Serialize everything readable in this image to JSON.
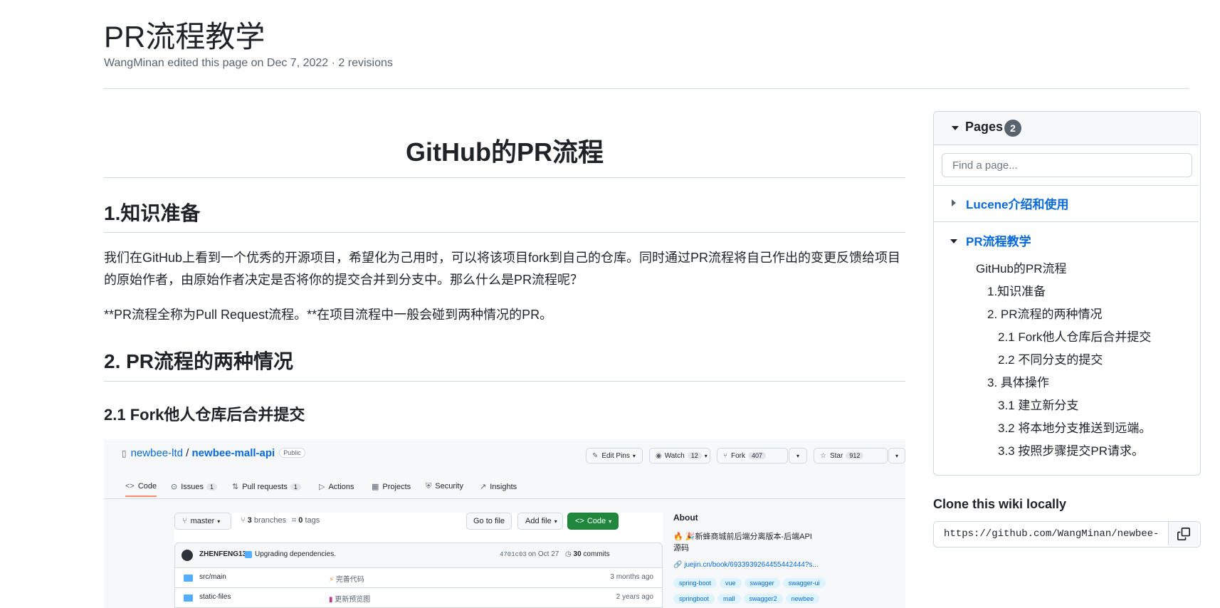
{
  "header": {
    "title": "PR流程教学",
    "meta": "WangMinan edited this page on Dec 7, 2022 · 2 revisions"
  },
  "article": {
    "h1": "GitHub的PR流程",
    "sec1_heading": "1.知识准备",
    "sec1_para1": "我们在GitHub上看到一个优秀的开源项目，希望化为己用时，可以将该项目fork到自己的仓库。同时通过PR流程将自己作出的变更反馈给项目的原始作者，由原始作者决定是否将你的提交合并到分支中。那么什么是PR流程呢？",
    "sec1_para2": "**PR流程全称为Pull Request流程。**在项目流程中一般会碰到两种情况的PR。",
    "sec2_heading": "2. PR流程的两种情况",
    "sec21_heading": "2.1 Fork他人仓库后合并提交"
  },
  "screenshot": {
    "owner": "newbee-ltd",
    "separator": " / ",
    "repo": "newbee-mall-api",
    "visibility": "Public",
    "edit_pins": "Edit Pins",
    "watch": "Watch",
    "watch_count": "12",
    "fork": "Fork",
    "fork_count": "407",
    "star": "Star",
    "star_count": "912",
    "tabs": [
      {
        "label": "Code",
        "icon": "<>"
      },
      {
        "label": "Issues",
        "icon": "⊙",
        "count": "1"
      },
      {
        "label": "Pull requests",
        "icon": "⇅",
        "count": "1"
      },
      {
        "label": "Actions",
        "icon": "▷"
      },
      {
        "label": "Projects",
        "icon": "▦"
      },
      {
        "label": "Security",
        "icon": "⛨"
      },
      {
        "label": "Insights",
        "icon": "↗"
      }
    ],
    "branch": "master",
    "branches_count": "3",
    "branches_label": "branches",
    "tags_count": "0",
    "tags_label": "tags",
    "go_to_file": "Go to file",
    "add_file": "Add file",
    "code_button": "Code",
    "commit_author": "ZHENFENG13",
    "commit_message": "Upgrading dependencies.",
    "commit_hash": "4701c03",
    "commit_date": "on Oct 27",
    "commits_count": "30",
    "commits_label": "commits",
    "files": [
      {
        "name": "src/main",
        "message": "完善代码",
        "age": "3 months ago"
      },
      {
        "name": "static-files",
        "message": "更新预览图",
        "age": "2 years ago"
      }
    ],
    "about_title": "About",
    "about_desc": "🔥 🎉新蜂商城前后端分离版本-后端API源码",
    "about_link": "juejin.cn/book/6933939264455442444?s...",
    "topics_row1": [
      "spring-boot",
      "vue",
      "swagger",
      "swagger-ui"
    ],
    "topics_row2": [
      "springboot",
      "mall",
      "swagger2",
      "newbee"
    ]
  },
  "sidebar": {
    "pages_label": "Pages",
    "pages_count": "2",
    "search_placeholder": "Find a page...",
    "page1": "Lucene介绍和使用",
    "page2": "PR流程教学",
    "toc": [
      "GitHub的PR流程",
      "1.知识准备",
      "2. PR流程的两种情况",
      "2.1 Fork他人仓库后合并提交",
      "2.2 不同分支的提交",
      "3. 具体操作",
      "3.1 建立新分支",
      "3.2 将本地分支推送到远端。",
      "3.3 按照步骤提交PR请求。"
    ],
    "clone_title": "Clone this wiki locally",
    "clone_url": "https://github.com/WangMinan/newbee-mall-api.wiki.git"
  },
  "colors": {
    "link": "#0969da",
    "text": "#1f2328",
    "muted": "#59636e",
    "border": "#d1d9e0",
    "green": "#1f883d"
  }
}
